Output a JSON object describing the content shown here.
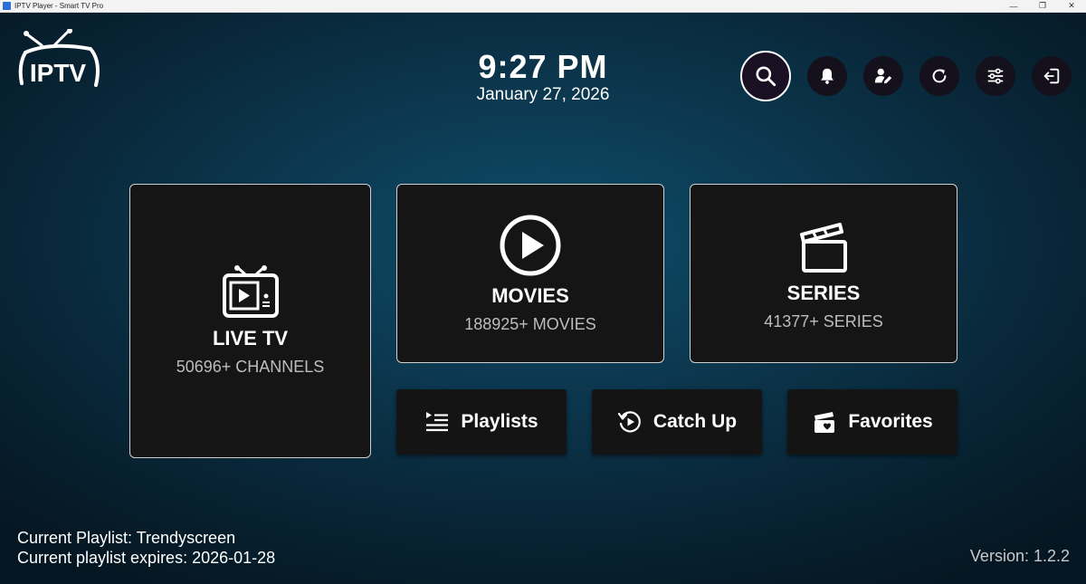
{
  "window": {
    "title": "IPTV Player - Smart TV Pro",
    "minimize": "—",
    "restore": "❐",
    "close": "✕"
  },
  "logo": {
    "text": "IPTV"
  },
  "clock": {
    "time": "9:27 PM",
    "date": "January 27, 2026"
  },
  "toolbar": {
    "icons": [
      "search-icon",
      "bell-icon",
      "user-edit-icon",
      "refresh-icon",
      "settings-sliders-icon",
      "logout-icon"
    ]
  },
  "tiles": {
    "live": {
      "title": "LIVE TV",
      "subtitle": "50696+ CHANNELS"
    },
    "movies": {
      "title": "MOVIES",
      "subtitle": "188925+ MOVIES"
    },
    "series": {
      "title": "SERIES",
      "subtitle": "41377+ SERIES"
    }
  },
  "buttons": {
    "playlists": "Playlists",
    "catchup": "Catch Up",
    "favorites": "Favorites"
  },
  "footer": {
    "current_playlist": "Current Playlist: Trendyscreen",
    "expires": "Current playlist expires: 2026-01-28",
    "version": "Version: 1.2.2"
  },
  "colors": {
    "tile_bg": "#151515",
    "accent_border": "#ffffff",
    "bg": "#0b3349"
  }
}
